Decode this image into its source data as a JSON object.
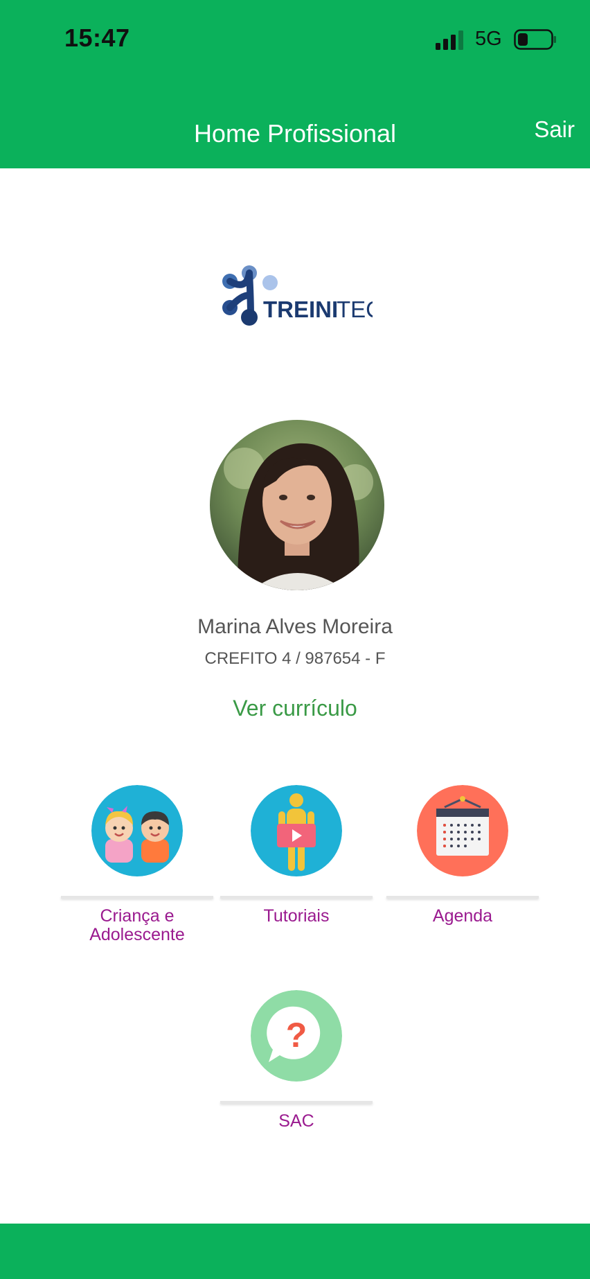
{
  "status_bar": {
    "time": "15:47",
    "network": "5G",
    "signal_icon": "signal-bars-icon",
    "battery_icon": "battery-icon"
  },
  "nav": {
    "title": "Home Profissional",
    "logout_label": "Sair"
  },
  "brand": {
    "logo_text_bold": "TREINI",
    "logo_text_light": "TEC"
  },
  "profile": {
    "name": "Marina Alves Moreira",
    "registration": "CREFITO 4 / 987654 - F",
    "cv_link": "Ver currículo"
  },
  "menu": {
    "items": [
      {
        "label_line1": "Criança e",
        "label_line2": "Adolescente",
        "icon": "children-icon"
      },
      {
        "label_line1": "Tutoriais",
        "label_line2": "",
        "icon": "tutorial-video-icon"
      },
      {
        "label_line1": "Agenda",
        "label_line2": "",
        "icon": "calendar-icon"
      },
      {
        "label_line1": "SAC",
        "label_line2": "",
        "icon": "help-chat-icon"
      }
    ]
  },
  "colors": {
    "header_green": "#0bb15b",
    "link_green": "#3a9a46",
    "menu_label_purple": "#9a1a8f",
    "text_gray": "#555555"
  }
}
